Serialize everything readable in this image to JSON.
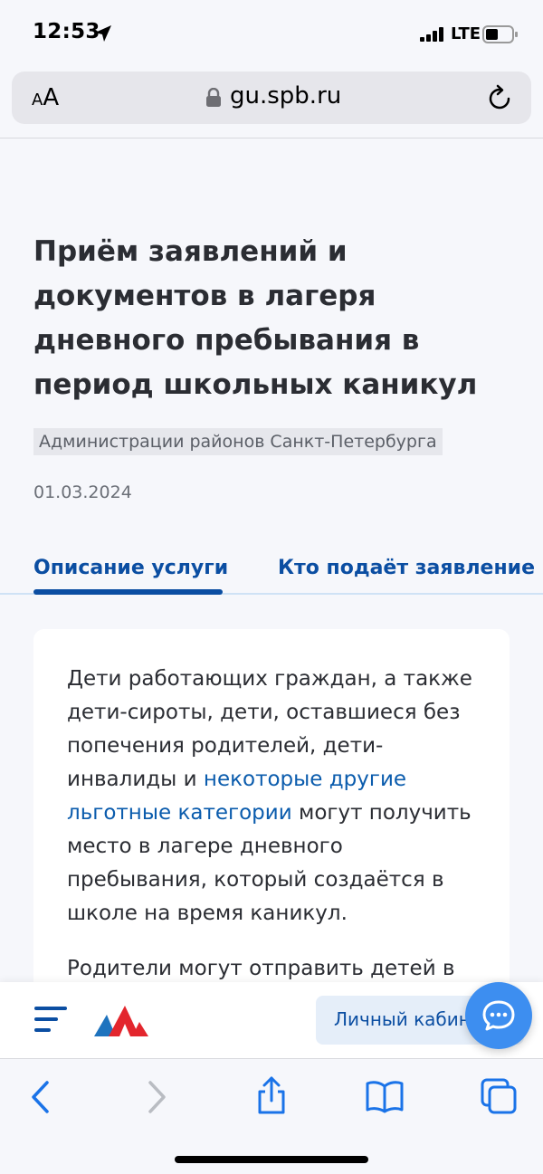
{
  "status": {
    "time": "12:53",
    "network": "LTE"
  },
  "browser": {
    "text_size_small": "A",
    "text_size_large": "A",
    "url": "gu.spb.ru"
  },
  "page": {
    "title": "Приём заявлений и документов в лагеря дневного пребывания в период школьных каникул",
    "department": "Администрации районов Санкт-Петербурга",
    "date": "01.03.2024",
    "tabs": [
      {
        "label": "Описание услуги",
        "active": true
      },
      {
        "label": "Кто подаёт заявление",
        "active": false
      }
    ],
    "description": {
      "text_before": "Дети работающих граждан, а также дети-сироты, дети, оставшиеся без попечения родителей, дети-инвалиды и ",
      "link": "некоторые другие льготные категории",
      "text_after": " могут получить место в лагере дневного пребывания, который создаётся в школе на время каникул.",
      "next_paragraph": "Родители могут отправить детей в"
    }
  },
  "site_bar": {
    "cabinet_label": "Личный кабинет"
  },
  "colors": {
    "accent": "#0b4ea2",
    "link": "#0b5cad",
    "chat": "#3d8ef0",
    "logo_red": "#e3262d",
    "logo_blue": "#1e73be"
  },
  "icons": [
    "location-arrow-icon",
    "signal-icon",
    "battery-icon",
    "lock-icon",
    "reload-icon",
    "menu-icon",
    "chat-icon",
    "back-icon",
    "forward-icon",
    "share-icon",
    "bookmarks-icon",
    "tabs-icon"
  ]
}
